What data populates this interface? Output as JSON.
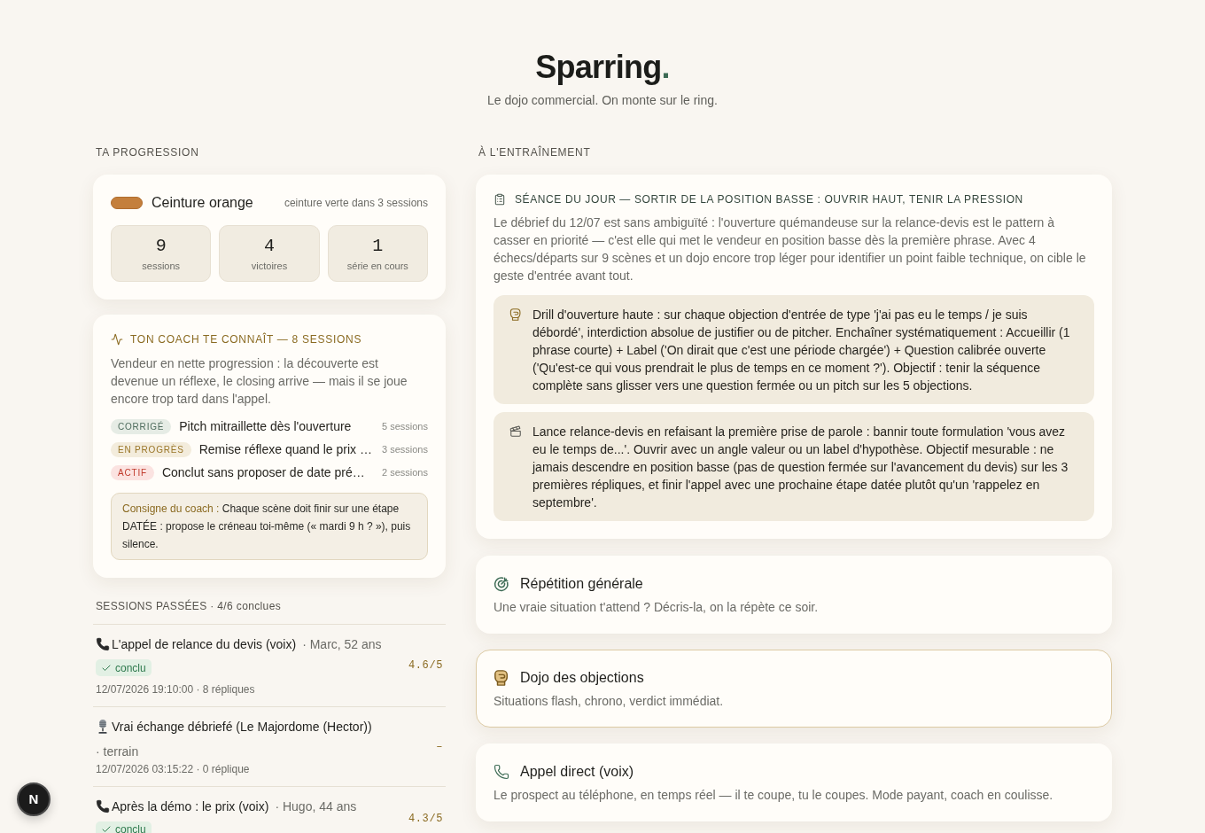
{
  "header": {
    "title": "Sparring",
    "title_accent": ".",
    "tagline": "Le dojo commercial. On monte sur le ring."
  },
  "progress": {
    "heading": "TA PROGRESSION",
    "belt": {
      "label": "Ceinture orange",
      "next": "ceinture verte dans 3 sessions"
    },
    "stats": [
      {
        "value": "9",
        "label": "sessions"
      },
      {
        "value": "4",
        "label": "victoires"
      },
      {
        "value": "1",
        "label": "série en cours"
      }
    ]
  },
  "coach": {
    "heading": "TON COACH TE CONNAÎT — 8 SESSIONS",
    "summary": "Vendeur en nette progression : la découverte est devenue un réflexe, le closing arrive — mais il se joue encore trop tard dans l'appel.",
    "weaknesses": [
      {
        "kind": "corrected",
        "badge": "CORRIGÉ",
        "label": "Pitch mitraillette dès l'ouverture",
        "count": "5 sessions"
      },
      {
        "kind": "progress",
        "badge": "EN PROGRÈS",
        "label": "Remise réflexe quand le prix …",
        "count": "3 sessions"
      },
      {
        "kind": "active",
        "badge": "ACTIF",
        "label": "Conclut sans proposer de date pré…",
        "count": "2 sessions"
      }
    ],
    "instruction": {
      "label": "Consigne du coach :",
      "text": "Chaque scène doit finir sur une étape DATÉE : propose le créneau toi-même (« mardi 9 h ? »), puis silence."
    }
  },
  "past_sessions": {
    "heading": "SESSIONS PASSÉES · 4/6 conclues",
    "items": [
      {
        "kind": "voice",
        "title": "L'appel de relance du devis (voix)",
        "meta": "· Marc, 52 ans",
        "badge": "conclu",
        "details": "12/07/2026 19:10:00 · 8 répliques",
        "score": "4.6/5"
      },
      {
        "kind": "debrief",
        "title": "Vrai échange débriefé (Le Majordome (Hector))",
        "meta": "· terrain",
        "details": "12/07/2026 03:15:22 · 0 réplique",
        "score": "–"
      },
      {
        "kind": "voice",
        "title": "Après la démo : le prix (voix)",
        "meta": "· Hugo, 44 ans",
        "badge": "conclu",
        "score": "4.3/5"
      }
    ]
  },
  "training": {
    "heading": "À L'ENTRAÎNEMENT",
    "session_of_day": {
      "title": "SÉANCE DU JOUR — SORTIR DE LA POSITION BASSE : OUVRIR HAUT, TENIR LA PRESSION",
      "summary": "Le débrief du 12/07 est sans ambiguïté : l'ouverture quémandeuse sur la relance-devis est le pattern à casser en priorité — c'est elle qui met le vendeur en position basse dès la première phrase. Avec 4 échecs/départs sur 9 scènes et un dojo encore trop léger pour identifier un point faible technique, on cible le geste d'entrée avant tout.",
      "drills": [
        "Drill d'ouverture haute : sur chaque objection d'entrée de type 'j'ai pas eu le temps / je suis débordé', interdiction absolue de justifier ou de pitcher. Enchaîner systématiquement : Accueillir (1 phrase courte) + Label ('On dirait que c'est une période chargée') + Question calibrée ouverte ('Qu'est-ce qui vous prendrait le plus de temps en ce moment ?'). Objectif : tenir la séquence complète sans glisser vers une question fermée ou un pitch sur les 5 objections.",
        "Lance relance-devis en refaisant la première prise de parole : bannir toute formulation 'vous avez eu le temps de...'. Ouvrir avec un angle valeur ou un label d'hypothèse. Objectif mesurable : ne jamais descendre en position basse (pas de question fermée sur l'avancement du devis) sur les 3 premières répliques, et finir l'appel avec une prochaine étape datée plutôt qu'un 'rappelez en septembre'."
      ]
    },
    "modes": [
      {
        "title": "Répétition générale",
        "description": "Une vraie situation t'attend ? Décris-la, on la répète ce soir.",
        "selected": false
      },
      {
        "title": "Dojo des objections",
        "description": "Situations flash, chrono, verdict immédiat.",
        "selected": true
      },
      {
        "title": "Appel direct (voix)",
        "description": "Le prospect au téléphone, en temps réel — il te coupe, tu le coupes. Mode payant, coach en coulisse.",
        "selected": false
      }
    ]
  },
  "dev_indicator": "N"
}
